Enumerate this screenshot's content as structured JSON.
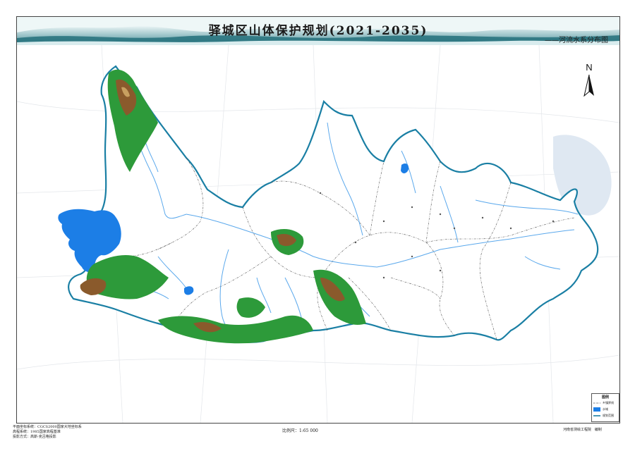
{
  "header": {
    "title": "驿城区山体保护规划(2021-2035)",
    "subtitle": "——河流水系分布图"
  },
  "north_arrow": {
    "label": "N"
  },
  "legend": {
    "title": "图例",
    "items": [
      {
        "label": "乡镇界线",
        "symbol": "dash-dot-line"
      },
      {
        "label": "水域",
        "symbol": "blue-fill"
      },
      {
        "label": "规划范围",
        "symbol": "blue-line"
      }
    ]
  },
  "footer": {
    "left_lines": [
      "平面坐标系统：CGCS2000国家大地坐标系",
      "高程系统：1985国家高程基准",
      "投影方式：高斯-克吕格投影"
    ],
    "scale": "比例尺：1:65 000",
    "publisher": "河南省测绘工程院",
    "compiled": "编制"
  },
  "colors": {
    "header_teal": "#3c8c96",
    "boundary": "#1a7fa4",
    "water": "#1c7ee6",
    "river": "#5aa8ec",
    "mountain_green": "#2d9a3a",
    "mountain_brown": "#8a5a2c"
  }
}
